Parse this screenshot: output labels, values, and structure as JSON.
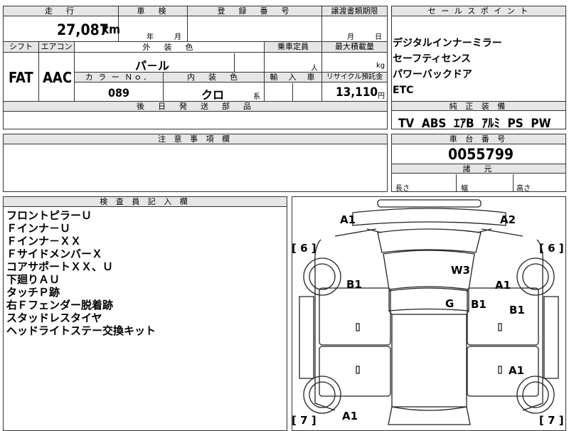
{
  "top": {
    "labels": {
      "mileage": "走　行",
      "inspection": "車　検",
      "registration": "登　録　番　号",
      "transfer": "譲渡書類期限",
      "shift": "シフト",
      "aircon": "エアコン",
      "exterior": "外　装　色",
      "capacity": "乗車定員",
      "loadcap": "最大積載量",
      "color_no": "カ ラ ー Ｎｏ．",
      "interior": "内　装　色",
      "import": "輸　入　車",
      "recycle": "リサイクル預託金",
      "later_parts": "後　日　発　送　部　品"
    },
    "mileage_value": "27,087",
    "mileage_unit": "km",
    "year_unit": "年",
    "month_unit": "月",
    "transfer_month": "月",
    "transfer_day": "日",
    "shift_value": "FAT",
    "aircon_value": "AAC",
    "exterior_value": "パ－ル",
    "capacity_unit": "人",
    "load_unit": "kg",
    "color_no_value": "089",
    "interior_value": "クロ",
    "interior_suffix": "系",
    "recycle_value": "13,110",
    "recycle_unit": "円"
  },
  "sales_points": {
    "header": "セ ー ル ス ポ イ ン ト",
    "items": [
      "デジタルインナーミラー",
      "セーフティセンス",
      "パワーバックドア",
      "ETC"
    ]
  },
  "equipment": {
    "header": "純 正 装 備",
    "value": "TV  ABS  ｴｱB  ｱﾙﾐ  PS  PW"
  },
  "caution": {
    "header": "注 意 事 項 欄"
  },
  "chassis": {
    "header": "車 台 番 号",
    "value": "0055799",
    "dims_header": "諸　元",
    "length": "長さ",
    "width": "幅",
    "height": "高さ"
  },
  "inspector": {
    "header": "検 査 員 記 入 欄",
    "notes": [
      "フロントピラーＵ",
      "Ｆインナ－Ｕ",
      "Ｆインナ－ＸＸ",
      "ＦサイドメンバーＸ",
      "コアサポートＸＸ、Ｕ",
      "下廻りＡＵ",
      "タッチＰ跡",
      "右Ｆフェンダー脱着跡",
      "スタッドレスタイヤ",
      "ヘッドライトステー交換キット"
    ]
  },
  "diagram": {
    "bracket_left_top": "[ 6 ]",
    "bracket_right_top": "[ 6 ]",
    "bracket_left_bottom": "[ 7 ]",
    "bracket_right_bottom": "[ 7 ]",
    "marks": {
      "a1_topleft": "A1",
      "a2_topright": "A2",
      "b1_left": "B1",
      "w3": "W3",
      "a1_right": "A1",
      "g": "G",
      "b1_center": "B1",
      "b1_right": "B1",
      "a1_lower_right": "A1",
      "a1_bottom": "A1"
    }
  }
}
